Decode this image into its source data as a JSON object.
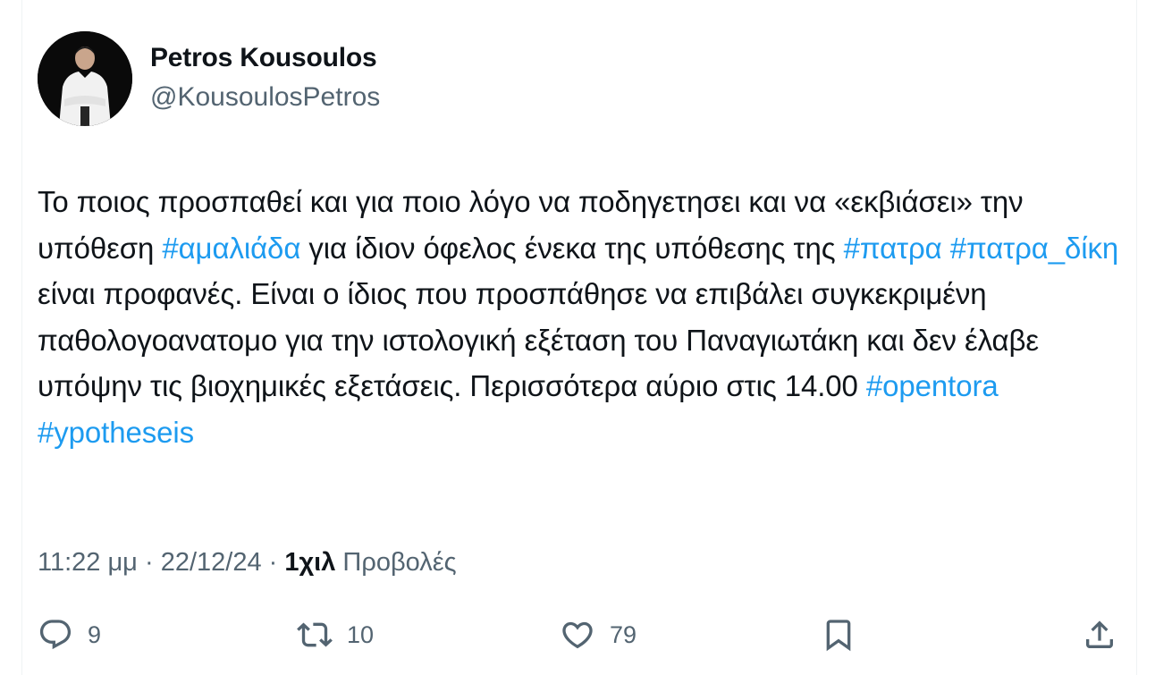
{
  "user": {
    "display_name": "Petros Kousoulos",
    "handle": "@KousoulosPetros",
    "avatar_icon": "profile-photo"
  },
  "tweet": {
    "segments": [
      {
        "text": "Το ποιος προσπαθεί και για ποιο λόγο να ποδηγετησει και να «εκβιάσει» την υπόθεση ",
        "hashtag": false
      },
      {
        "text": "#αμαλιάδα",
        "hashtag": true
      },
      {
        "text": " για ίδιον όφελος ένεκα της υπόθεσης της ",
        "hashtag": false
      },
      {
        "text": "#πατρα",
        "hashtag": true
      },
      {
        "text": " ",
        "hashtag": false
      },
      {
        "text": "#πατρα_δίκη",
        "hashtag": true
      },
      {
        "text": " είναι προφανές. Είναι ο ίδιος που προσπάθησε να επιβάλει συγκεκριμένη παθολογοανατομο για την ιστολογική εξέταση του Παναγιωτάκη και δεν έλαβε υπόψην τις βιοχημικές εξετάσεις. Περισσότερα αύριο στις 14.00 ",
        "hashtag": false
      },
      {
        "text": "#opentora",
        "hashtag": true
      },
      {
        "text": " ",
        "hashtag": false
      },
      {
        "text": "#ypotheseis",
        "hashtag": true
      }
    ]
  },
  "meta": {
    "time": "11:22 μμ",
    "separator": " · ",
    "date": "22/12/24",
    "views_count": "1χιλ",
    "views_label": " Προβολές"
  },
  "actions": {
    "reply": {
      "icon": "reply-icon",
      "count": "9"
    },
    "retweet": {
      "icon": "retweet-icon",
      "count": "10"
    },
    "like": {
      "icon": "heart-icon",
      "count": "79"
    },
    "bookmark": {
      "icon": "bookmark-icon"
    },
    "share": {
      "icon": "share-icon"
    }
  },
  "colors": {
    "text": "#0f1419",
    "secondary": "#536471",
    "hashtag": "#1d9bf0"
  }
}
